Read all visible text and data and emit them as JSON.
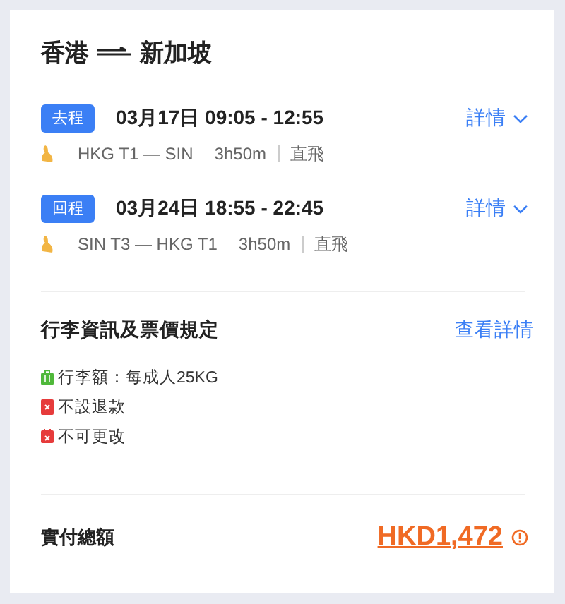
{
  "title": {
    "from": "香港",
    "to": "新加坡"
  },
  "segments": [
    {
      "tag": "去程",
      "datetime": "03月17日 09:05 - 12:55",
      "details": "詳情",
      "route": "HKG T1 — SIN",
      "duration": "3h50m",
      "stops": "直飛"
    },
    {
      "tag": "回程",
      "datetime": "03月24日 18:55 - 22:45",
      "details": "詳情",
      "route": "SIN T3 — HKG T1",
      "duration": "3h50m",
      "stops": "直飛"
    }
  ],
  "baggage": {
    "title": "行李資訊及票價規定",
    "link": "查看詳情",
    "rules": [
      {
        "kind": "baggage",
        "text": "行李額：每成人25KG"
      },
      {
        "kind": "refund",
        "text": "不設退款"
      },
      {
        "kind": "change",
        "text": "不可更改"
      }
    ]
  },
  "total": {
    "label": "實付總額",
    "amount": "HKD1,472"
  }
}
